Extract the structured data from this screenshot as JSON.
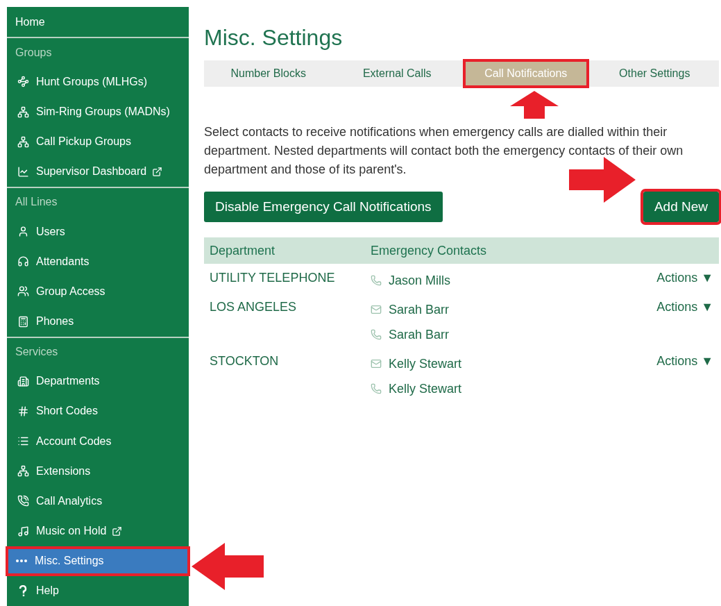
{
  "sidebar": {
    "items": [
      {
        "kind": "link",
        "label": "Home",
        "selected": false,
        "external": false
      },
      {
        "kind": "header",
        "label": "Groups"
      },
      {
        "kind": "item",
        "label": "Hunt Groups (MLHGs)",
        "selected": false,
        "external": false
      },
      {
        "kind": "item",
        "label": "Sim-Ring Groups (MADNs)",
        "selected": false,
        "external": false
      },
      {
        "kind": "item",
        "label": "Call Pickup Groups",
        "selected": false,
        "external": false
      },
      {
        "kind": "item",
        "label": "Supervisor Dashboard",
        "selected": false,
        "external": true
      },
      {
        "kind": "header",
        "label": "All Lines"
      },
      {
        "kind": "item",
        "label": "Users",
        "selected": false,
        "external": false
      },
      {
        "kind": "item",
        "label": "Attendants",
        "selected": false,
        "external": false
      },
      {
        "kind": "item",
        "label": "Group Access",
        "selected": false,
        "external": false
      },
      {
        "kind": "item",
        "label": "Phones",
        "selected": false,
        "external": false
      },
      {
        "kind": "header",
        "label": "Services"
      },
      {
        "kind": "item",
        "label": "Departments",
        "selected": false,
        "external": false
      },
      {
        "kind": "item",
        "label": "Short Codes",
        "selected": false,
        "external": false
      },
      {
        "kind": "item",
        "label": "Account Codes",
        "selected": false,
        "external": false
      },
      {
        "kind": "item",
        "label": "Extensions",
        "selected": false,
        "external": false
      },
      {
        "kind": "item",
        "label": "Call Analytics",
        "selected": false,
        "external": false
      },
      {
        "kind": "item",
        "label": "Music on Hold",
        "selected": false,
        "external": true
      },
      {
        "kind": "item",
        "label": "Misc. Settings",
        "selected": true,
        "external": false,
        "highlighted": true
      },
      {
        "kind": "item",
        "label": "Help",
        "selected": false,
        "external": false
      }
    ]
  },
  "page": {
    "title": "Misc. Settings",
    "tabs": [
      {
        "label": "Number Blocks",
        "selected": false,
        "highlighted": false
      },
      {
        "label": "External Calls",
        "selected": false,
        "highlighted": false
      },
      {
        "label": "Call Notifications",
        "selected": true,
        "highlighted": true
      },
      {
        "label": "Other Settings",
        "selected": false,
        "highlighted": false
      }
    ],
    "description": "Select contacts to receive notifications when emergency calls are dialled within their department. Nested departments will contact both the emergency contacts of their own department and those of its parent's.",
    "disable_button": "Disable Emergency Call Notifications",
    "add_button": {
      "label": "Add New",
      "highlighted": true
    },
    "table": {
      "columns": [
        "Department",
        "Emergency Contacts"
      ],
      "rows": [
        {
          "department": "UTILITY TELEPHONE",
          "contacts": [
            {
              "kind": "phone",
              "name": "Jason Mills"
            }
          ],
          "actions": "Actions ▼"
        },
        {
          "department": "LOS ANGELES",
          "contacts": [
            {
              "kind": "email",
              "name": "Sarah Barr"
            },
            {
              "kind": "phone",
              "name": "Sarah Barr"
            }
          ],
          "actions": "Actions ▼"
        },
        {
          "department": "STOCKTON",
          "contacts": [
            {
              "kind": "email",
              "name": "Kelly Stewart"
            },
            {
              "kind": "phone",
              "name": "Kelly Stewart"
            }
          ],
          "actions": "Actions ▼"
        }
      ]
    }
  }
}
